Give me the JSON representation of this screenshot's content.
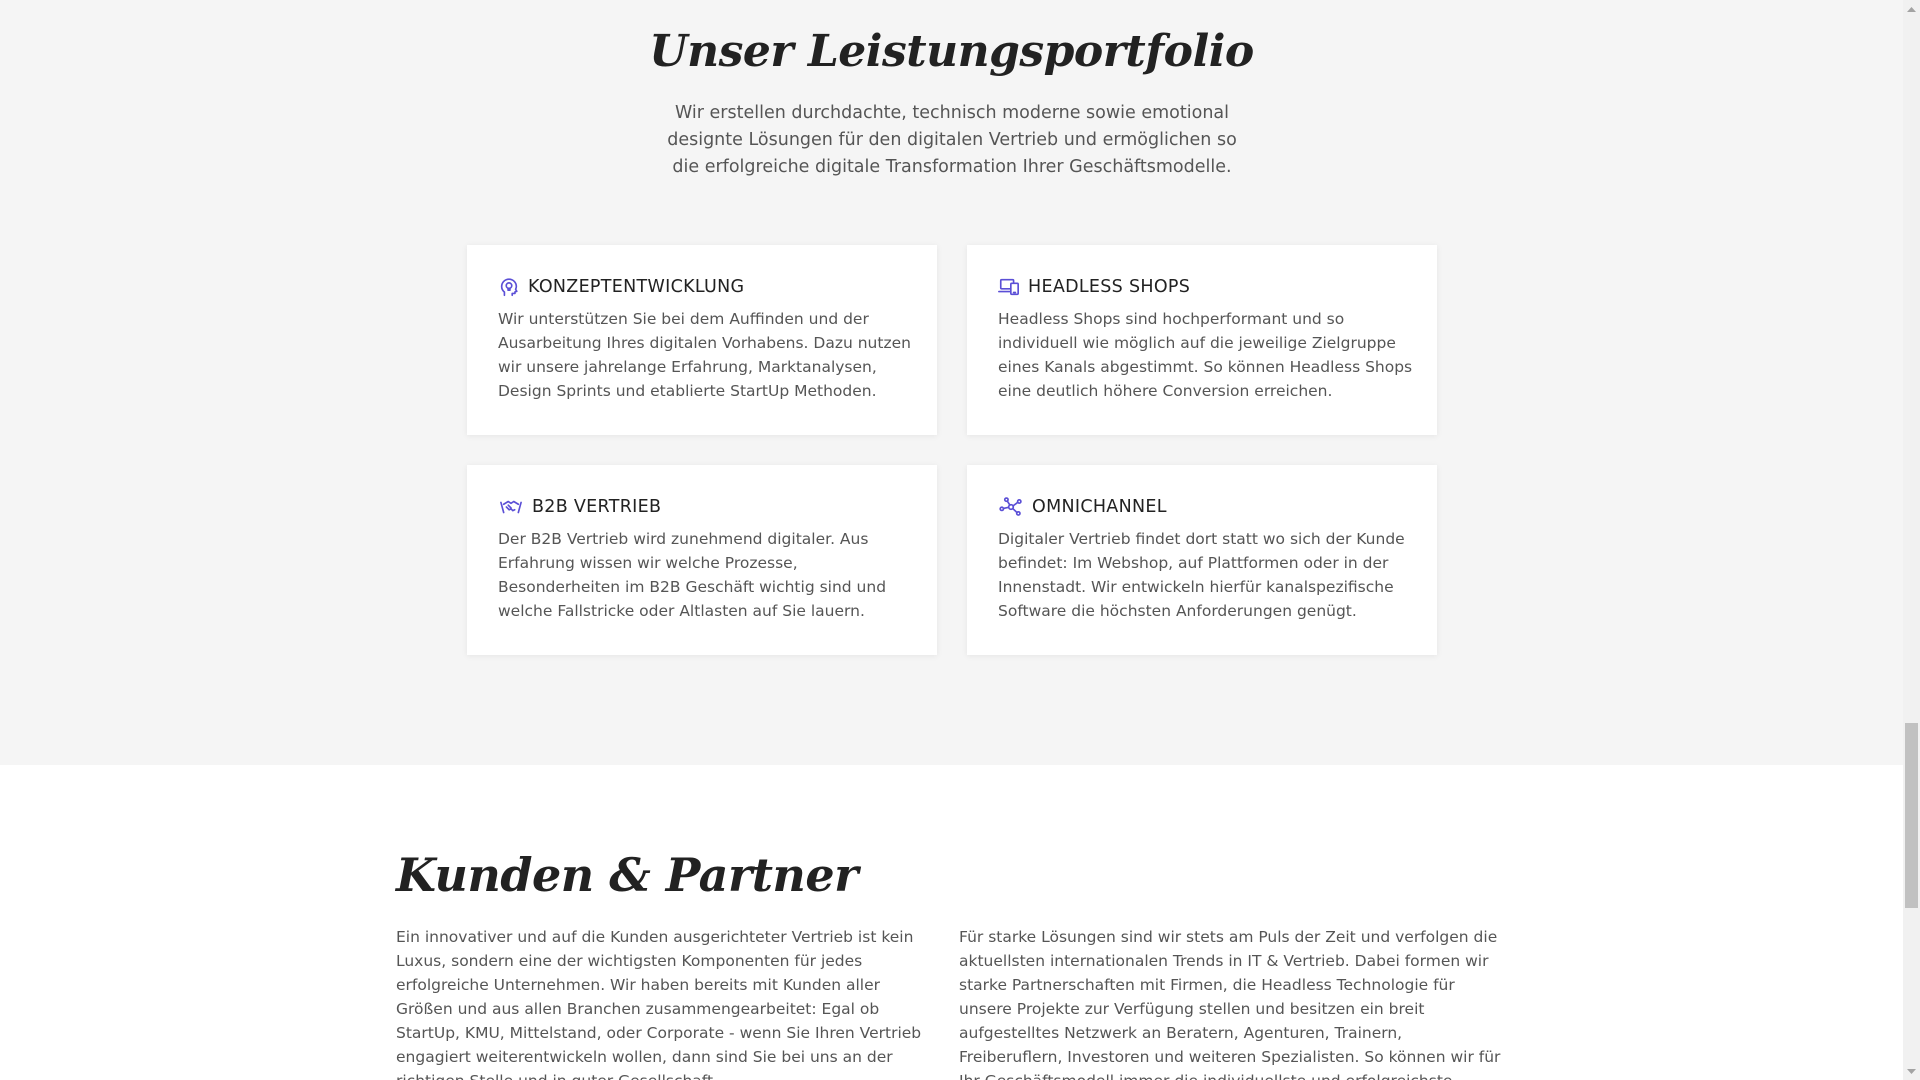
{
  "portfolio": {
    "title": "Unser Leistungsportfolio",
    "intro": "Wir erstellen durchdachte, technisch moderne sowie emotional designte Lösungen für den digitalen Vertrieb und ermöglichen so die erfolgreiche digitale Transformation Ihrer Geschäftsmodelle.",
    "cards": [
      {
        "icon": "lightbulb-head-icon",
        "title": "KONZEPTENTWICKLUNG",
        "text": "Wir unterstützen Sie bei dem Auffinden und der Ausarbeitung Ihres digitalen Vorhabens. Dazu nutzen wir unsere jahrelange Erfahrung, Marktanalysen, Design Sprints und etablierte StartUp Methoden."
      },
      {
        "icon": "devices-icon",
        "title": "HEADLESS SHOPS",
        "text": "Headless Shops sind hochperformant und so individuell wie möglich auf die jeweilige Zielgruppe eines Kanals abgestimmt. So können Headless Shops eine deutlich höhere Conversion erreichen."
      },
      {
        "icon": "handshake-icon",
        "title": "B2B VERTRIEB",
        "text": "Der B2B Vertrieb wird zunehmend digitaler. Aus Erfahrung wissen wir welche Prozesse, Besonderheiten im B2B Geschäft wichtig sind und welche Fallstricke oder Altlasten auf Sie lauern."
      },
      {
        "icon": "network-icon",
        "title": "OMNICHANNEL",
        "text": "Digitaler Vertrieb findet dort statt wo sich der Kunde befindet: Im Webshop, auf Plattformen oder in der Innenstadt. Wir entwickeln hierfür kanalspezifische Software die höchsten Anforderungen genügt."
      }
    ]
  },
  "partners": {
    "title": "Kunden & Partner",
    "left_text": "Ein innovativer und auf die Kunden ausgerichteter Vertrieb ist kein Luxus, sondern eine der wichtigsten Komponenten für jedes erfolgreiche Unternehmen. Wir haben bereits mit Kunden aller Größen und aus allen Branchen zusammengearbeitet: Egal ob StartUp, KMU, Mittelstand, oder Corporate - wenn Sie Ihren Vertrieb engagiert weiterentwickeln wollen, dann sind Sie bei uns an der richtigen Stelle und in guter Gesellschaft.",
    "right_text": "Für starke Lösungen sind wir stets am Puls der Zeit und verfolgen die aktuellsten internationalen Trends in IT & Vertrieb. Dabei formen wir starke Partnerschaften mit Firmen, die Headless Technologie für unsere Projekte zur Verfügung stellen und besitzen ein breit aufgestelltes Netzwerk an Beratern, Agenturen, Trainern, Freiberuflern, Investoren und weiteren Spezialisten. So können wir für Ihr Geschäftsmodell immer die individuellste und erfolgreichste Lösung umsetzen."
  },
  "colors": {
    "accent": "#5b4fd6",
    "section_bg": "#f5f5f5",
    "card_bg": "#ffffff",
    "heading": "#222222",
    "text": "#555555"
  }
}
